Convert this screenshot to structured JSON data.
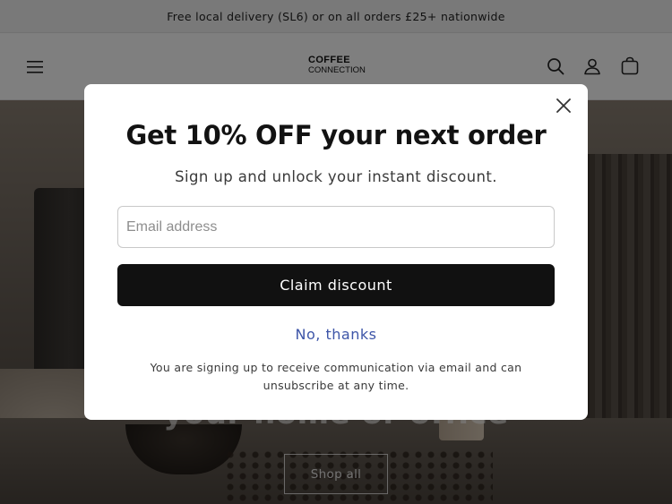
{
  "announcement": {
    "text": "Free local delivery (SL6) or on all orders £25+ nationwide"
  },
  "header": {
    "logo_line1": "COFFEE",
    "logo_line2": "CONNECTION",
    "icons": [
      "menu-icon",
      "search-icon",
      "account-icon",
      "cart-icon"
    ]
  },
  "hero": {
    "heading": "your home or office",
    "button_label": "Shop all"
  },
  "popup": {
    "title": "Get 10% OFF your next order",
    "subtitle": "Sign up and unlock your instant discount.",
    "email_placeholder": "Email address",
    "email_value": "",
    "claim_label": "Claim discount",
    "decline_label": "No, thanks",
    "disclaimer": "You are signing up to receive communication via email and can unsubscribe at any time.",
    "icons": [
      "close-icon"
    ]
  },
  "colors": {
    "primary_button": "#111111",
    "link": "#3d55a8",
    "overlay": "rgba(0,0,0,0.5)"
  }
}
